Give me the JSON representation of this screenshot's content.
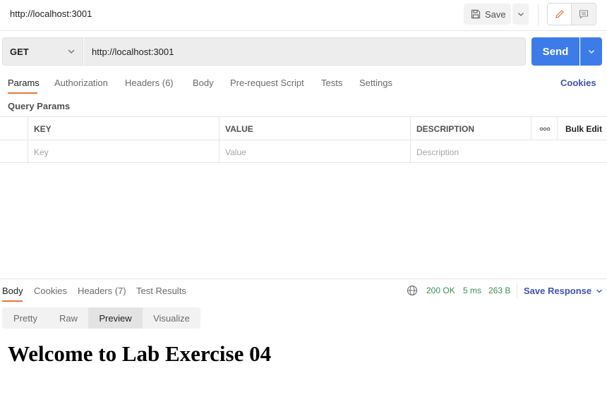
{
  "header": {
    "request_title": "http://localhost:3001",
    "save_label": "Save"
  },
  "request": {
    "method": "GET",
    "url": "http://localhost:3001",
    "send_label": "Send"
  },
  "request_tabs": {
    "params": "Params",
    "authorization": "Authorization",
    "headers": "Headers (6)",
    "body": "Body",
    "pre_request_script": "Pre-request Script",
    "tests": "Tests",
    "settings": "Settings",
    "cookies": "Cookies"
  },
  "query_params": {
    "title": "Query Params",
    "columns": {
      "key": "KEY",
      "value": "VALUE",
      "description": "DESCRIPTION",
      "bulk_edit": "Bulk Edit"
    },
    "placeholders": {
      "key": "Key",
      "value": "Value",
      "description": "Description"
    }
  },
  "response": {
    "tabs": {
      "body": "Body",
      "cookies": "Cookies",
      "headers": "Headers (7)",
      "test_results": "Test Results"
    },
    "status": "200 OK",
    "time": "5 ms",
    "size": "263 B",
    "save_response": "Save Response",
    "view_modes": {
      "pretty": "Pretty",
      "raw": "Raw",
      "preview": "Preview",
      "visualize": "Visualize"
    },
    "selected_view": "Preview",
    "preview_heading": "Welcome to Lab Exercise 04"
  },
  "colors": {
    "accent": "#3d7ce8",
    "tab_underline": "#e8773a",
    "link": "#3f51b5",
    "status_ok": "#3c8d55"
  },
  "icons": [
    "save-icon",
    "chevron-down-icon",
    "pencil-icon",
    "comment-icon",
    "more-horizontal-icon",
    "globe-icon"
  ]
}
